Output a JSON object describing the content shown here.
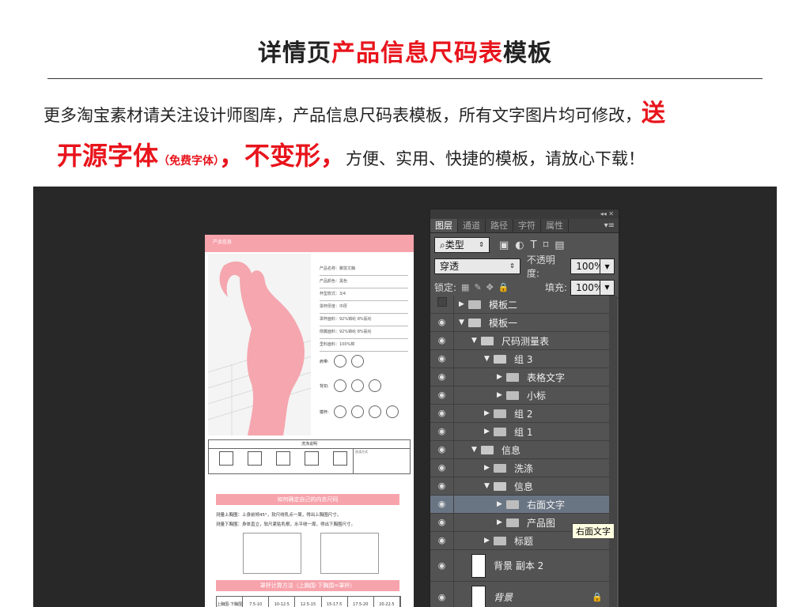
{
  "header": {
    "title_black": "详情页",
    "title_red": "产品信息尺码表",
    "title_black_end": "模板",
    "line1_text": "更多淘宝素材请关注设计师图库，产品信息尺码表模板，所有文字图片均可修改，",
    "line1_red": "送",
    "line2_red1": "开源字体",
    "line2_small": "（免费字体）",
    "line2_red2": "，不变形，",
    "line2_text": "方便、实用、快捷的模板，请放心下载！"
  },
  "document": {
    "bar_title": "产品信息",
    "specs": [
      "产品名称：聚拢文胸",
      "产品颜色：黑色",
      "杯型款式：3/4",
      "罩杯厚度：中厚",
      "罩杯面料：92%锦纶 8%氨纶",
      "侧翼面料：92%锦纶 8%氨纶",
      "里料面料：100%棉"
    ],
    "feature_labels": [
      "肩带:",
      "背扣:",
      "模杯:"
    ],
    "wash_title": "洗涤说明",
    "wash_method": "洗涤方式",
    "wash_icons": [
      "水温不高",
      "不可漂白",
      "不可熨烫",
      "不可干洗",
      "悬挂晾干"
    ],
    "section1": "如何确定自己的内衣尺码",
    "measure1": "测量上胸围：上身前倾45°，软尺绕乳点一周，得出上胸围尺寸。",
    "measure2": "测量下胸围：身体直立，软尺紧贴乳根，水平绕一周，得出下胸围尺寸。",
    "section2": "罩杯计算方法（上胸围-下胸围=罩杯）",
    "table_cells": [
      "上胸围-下胸围",
      "7.5-10",
      "10-12.5",
      "12.5-15",
      "15-17.5",
      "17.5-20",
      "20-22.5"
    ]
  },
  "panel": {
    "tabs": [
      "图层",
      "通道",
      "路径",
      "字符",
      "属性"
    ],
    "filter_select": "类型",
    "blend_mode": "穿透",
    "opacity_label": "不透明度:",
    "opacity_value": "100%",
    "lock_label": "锁定:",
    "fill_label": "填充:",
    "fill_value": "100%",
    "layers": [
      {
        "name": "模板二",
        "indent": 0,
        "caret": "▶",
        "eye": false
      },
      {
        "name": "模板一",
        "indent": 0,
        "caret": "▼",
        "eye": true
      },
      {
        "name": "尺码测量表",
        "indent": 1,
        "caret": "▼",
        "eye": true
      },
      {
        "name": "组 3",
        "indent": 2,
        "caret": "▼",
        "eye": true
      },
      {
        "name": "表格文字",
        "indent": 3,
        "caret": "▶",
        "eye": true
      },
      {
        "name": "小标",
        "indent": 3,
        "caret": "▶",
        "eye": true
      },
      {
        "name": "组 2",
        "indent": 2,
        "caret": "▶",
        "eye": true
      },
      {
        "name": "组 1",
        "indent": 2,
        "caret": "▶",
        "eye": true
      },
      {
        "name": "信息",
        "indent": 1,
        "caret": "▼",
        "eye": true
      },
      {
        "name": "洗涤",
        "indent": 2,
        "caret": "▶",
        "eye": true
      },
      {
        "name": "信息",
        "indent": 2,
        "caret": "▼",
        "eye": true
      },
      {
        "name": "右面文字",
        "indent": 3,
        "caret": "▶",
        "eye": true,
        "selected": true
      },
      {
        "name": "产品图",
        "indent": 3,
        "caret": "▶",
        "eye": true
      },
      {
        "name": "标题",
        "indent": 2,
        "caret": "▶",
        "eye": true
      }
    ],
    "bg_copy": "背景 副本 2",
    "bg": "背景",
    "tooltip": "右面文字"
  },
  "colors": {
    "accent_red": "#e8141c",
    "pink": "#f7a3ac",
    "panel_bg": "#535353",
    "canvas_bg": "#282828"
  }
}
